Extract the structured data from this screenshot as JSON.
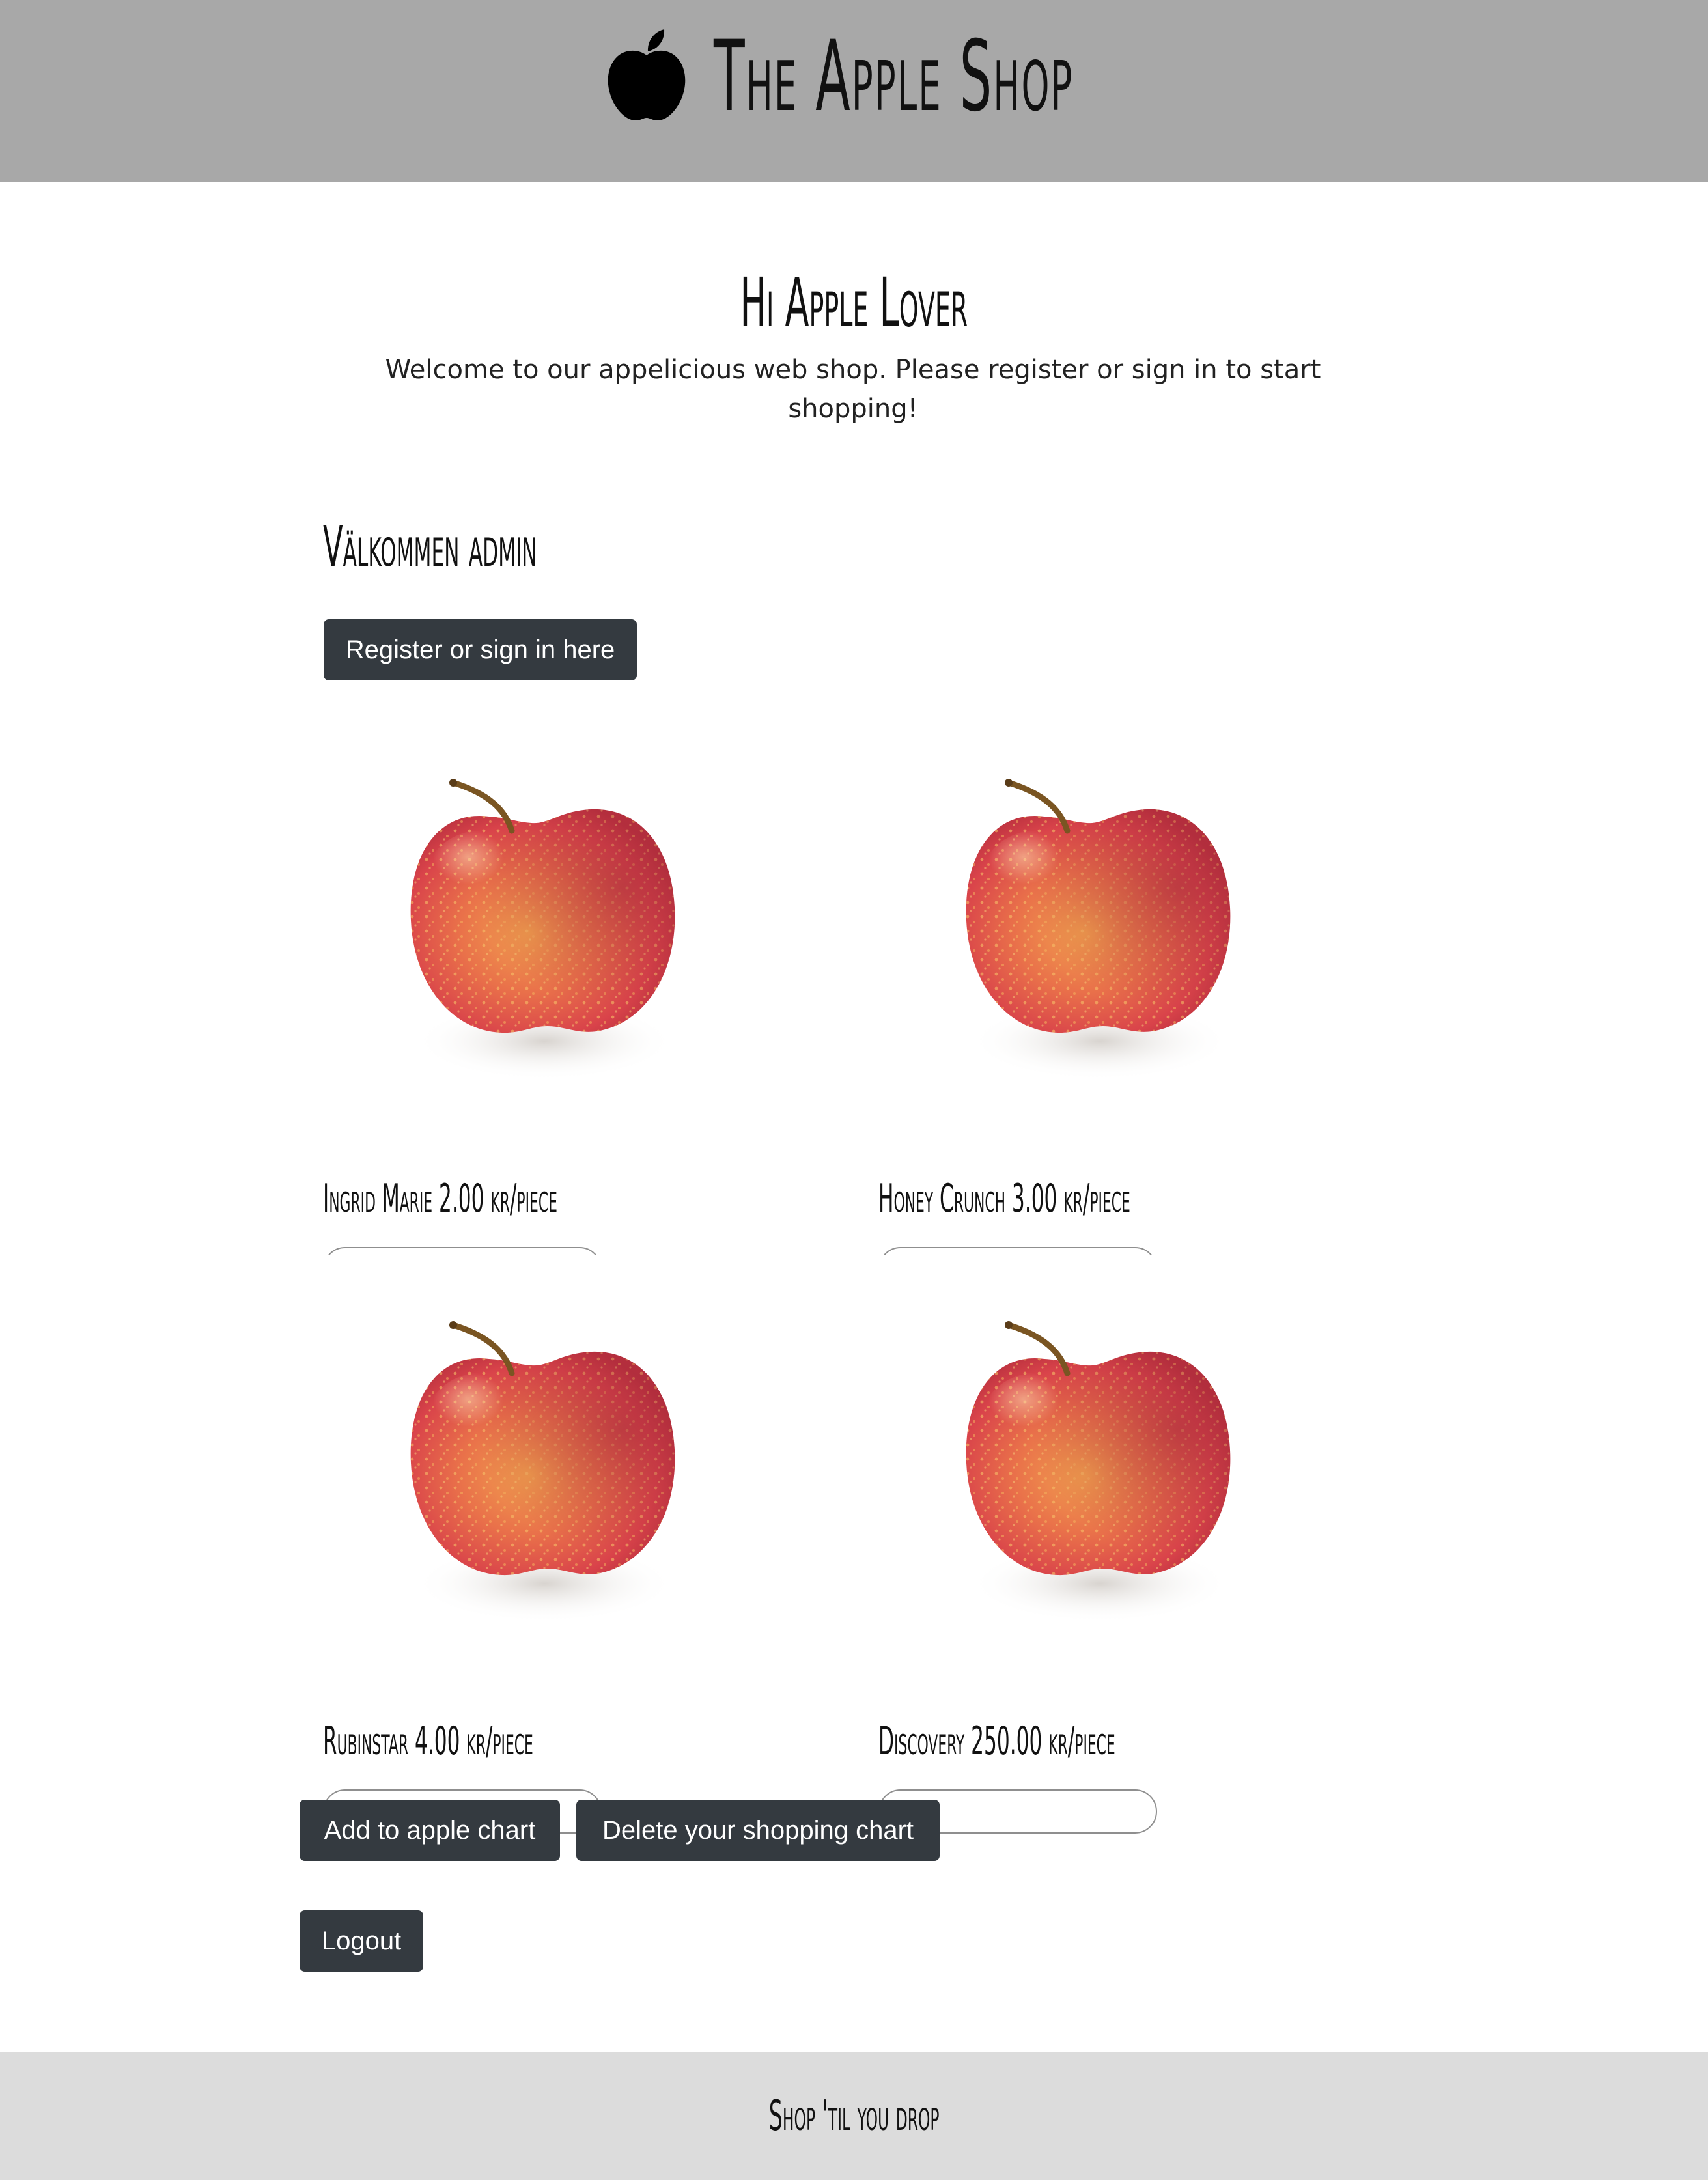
{
  "header": {
    "title": "The Apple Shop",
    "logo_icon": "apple-logo-icon"
  },
  "hero": {
    "title": "Hi Apple Lover",
    "text": "Welcome to our appelicious web shop. Please register or sign in to start shopping!"
  },
  "user": {
    "welcome": "Välkommen admin"
  },
  "actions": {
    "register_label": "Register or sign in here",
    "add_label": "Add to apple chart",
    "delete_label": "Delete your shopping chart",
    "logout_label": "Logout"
  },
  "products": [
    {
      "name": "Ingrid Marie",
      "price": "2.00",
      "unit": "kr/piece",
      "quantity": "",
      "image_icon": "apple-photo"
    },
    {
      "name": "Honey Crunch",
      "price": "3.00",
      "unit": "kr/piece",
      "quantity": "",
      "image_icon": "apple-photo"
    },
    {
      "name": "Rubinstar",
      "price": "4.00",
      "unit": "kr/piece",
      "quantity": "",
      "image_icon": "apple-photo"
    },
    {
      "name": "Discovery",
      "price": "250.00",
      "unit": "kr/piece",
      "quantity": "",
      "image_icon": "apple-photo"
    }
  ],
  "footer": {
    "text": "Shop 'til you drop"
  },
  "colors": {
    "header_bg": "#a8a8a8",
    "footer_bg": "#dcdcdc",
    "button_bg": "#343a40",
    "button_text": "#ffffff"
  }
}
